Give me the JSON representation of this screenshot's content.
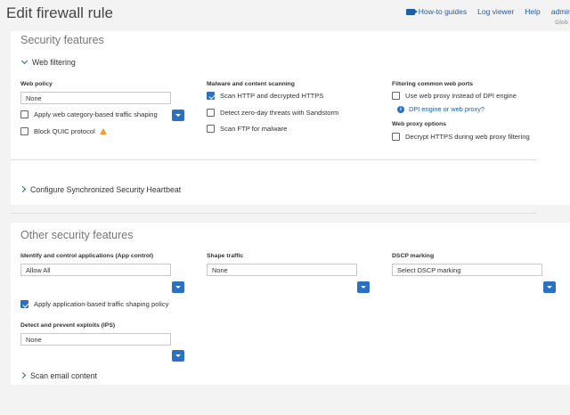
{
  "header": {
    "title": "Edit firewall rule",
    "links": [
      "How-to guides",
      "Log viewer",
      "Help"
    ],
    "user": "admir",
    "sub": "Glob"
  },
  "security": {
    "title": "Security features",
    "web_filtering": {
      "label": "Web filtering",
      "web_policy_label": "Web policy",
      "web_policy_value": "None",
      "apply_shaping": "Apply web category-based traffic shaping",
      "block_quic": "Block QUIC protocol",
      "malware_label": "Malware and content scanning",
      "scan_http": "Scan HTTP and decrypted HTTPS",
      "zero_day": "Detect zero-day threats with Sandstorm",
      "scan_ftp": "Scan FTP for malware",
      "ports_label": "Filtering common web ports",
      "use_proxy": "Use web proxy instead of DPI engine",
      "dpi_link": "DPI engine or web proxy?",
      "proxy_options_label": "Web proxy options",
      "decrypt_https": "Decrypt HTTPS during web proxy filtering"
    },
    "heartbeat_label": "Configure Synchronized Security Heartbeat"
  },
  "other": {
    "title": "Other security features",
    "app_control_label": "Identify and control applications (App control)",
    "app_control_value": "Allow All",
    "shape_label": "Shape traffic",
    "shape_value": "None",
    "dscp_label": "DSCP marking",
    "dscp_value": "Select DSCP marking",
    "apply_app_shaping": "Apply application-based traffic shaping policy",
    "ips_label": "Detect and prevent exploits (IPS)",
    "ips_value": "None",
    "scan_email": "Scan email content"
  }
}
